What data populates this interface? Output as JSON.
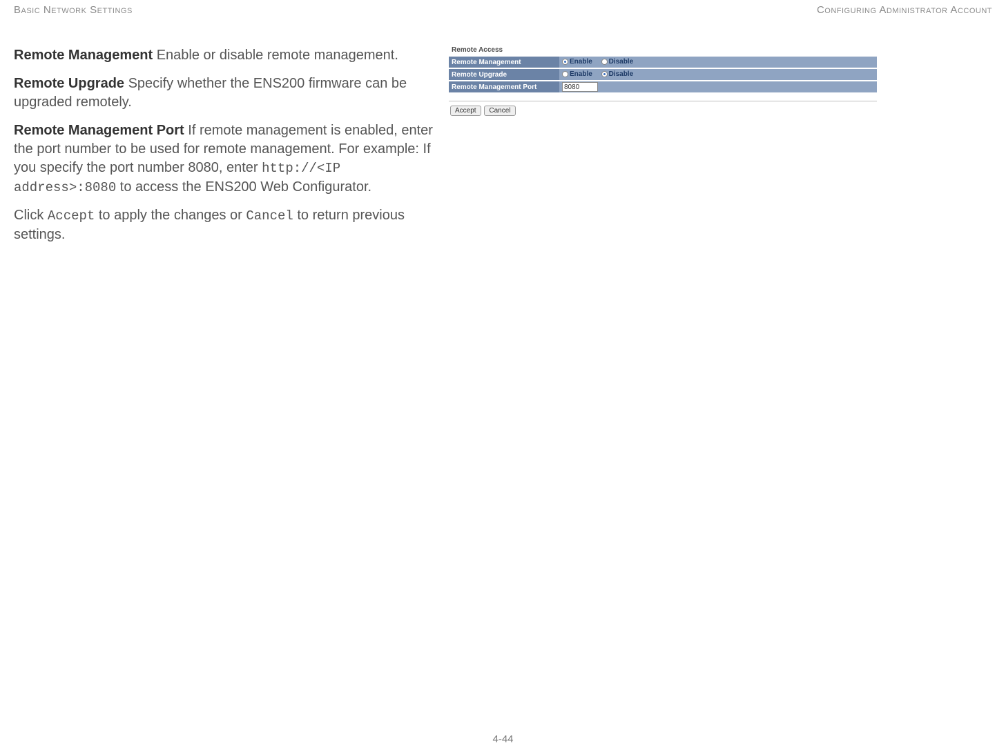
{
  "header": {
    "left": "Basic Network Settings",
    "right": "Configuring Administrator Account"
  },
  "descriptions": {
    "remote_management": {
      "term": "Remote Management",
      "text": "  Enable or disable remote management."
    },
    "remote_upgrade": {
      "term": "Remote Upgrade",
      "text": "  Specify whether the ENS200 firmware can be upgraded remotely."
    },
    "remote_management_port": {
      "term": "Remote Management Port",
      "text_before": "  If remote management is enabled, enter the port number to be used for remote management. For example: If you specify the port number 8080, enter ",
      "code": "http://<IP address>:8080",
      "text_after": " to access the ENS200 Web Configurator."
    },
    "click_line": {
      "pre": "Click ",
      "accept": "Accept",
      "mid": " to apply the changes or ",
      "cancel": "Cancel",
      "post": " to return previous settings."
    }
  },
  "panel": {
    "title": "Remote Access",
    "rows": {
      "remote_management": {
        "label": "Remote Management",
        "enable": "Enable",
        "disable": "Disable",
        "selected": "enable"
      },
      "remote_upgrade": {
        "label": "Remote Upgrade",
        "enable": "Enable",
        "disable": "Disable",
        "selected": "disable"
      },
      "remote_management_port": {
        "label": "Remote Management Port",
        "value": "8080"
      }
    },
    "buttons": {
      "accept": "Accept",
      "cancel": "Cancel"
    }
  },
  "page_number": "4-44"
}
